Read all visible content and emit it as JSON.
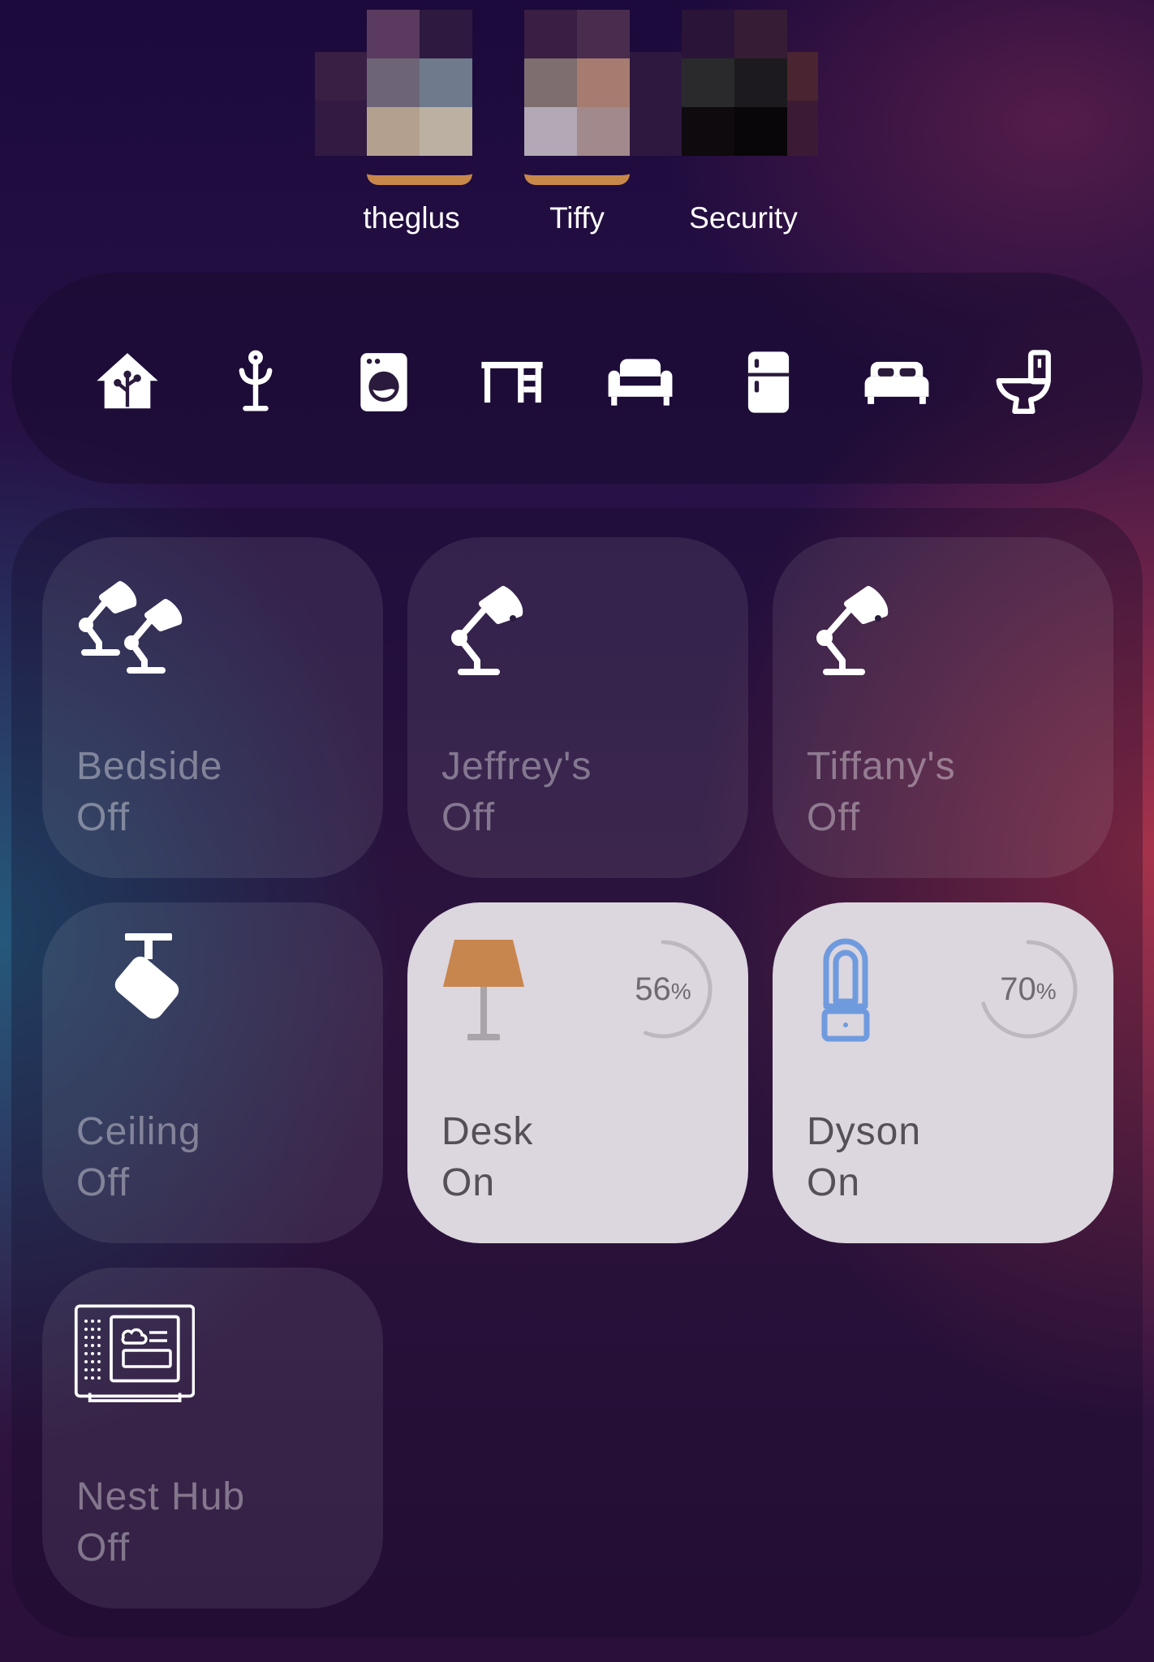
{
  "people": [
    {
      "name": "theglus",
      "accent": "#c8884a"
    },
    {
      "name": "Tiffy",
      "accent": "#c8884a"
    },
    {
      "name": "Security",
      "accent": "#4a2a3c"
    }
  ],
  "areas": [
    {
      "icon": "home-assistant-icon"
    },
    {
      "icon": "coat-rack-icon"
    },
    {
      "icon": "washing-machine-icon"
    },
    {
      "icon": "desk-icon"
    },
    {
      "icon": "sofa-icon"
    },
    {
      "icon": "fridge-icon"
    },
    {
      "icon": "bed-icon"
    },
    {
      "icon": "toilet-icon"
    }
  ],
  "tiles": [
    {
      "name": "Bedside",
      "state": "Off",
      "icon": "desk-lamp-double-icon"
    },
    {
      "name": "Jeffrey's",
      "state": "Off",
      "icon": "desk-lamp-icon"
    },
    {
      "name": "Tiffany's",
      "state": "Off",
      "icon": "desk-lamp-icon"
    },
    {
      "name": "Ceiling",
      "state": "Off",
      "icon": "ceiling-light-icon"
    },
    {
      "name": "Desk",
      "state": "On",
      "icon": "floor-lamp-icon",
      "level": 56,
      "level_unit": "%",
      "icon_color": "#c8864f"
    },
    {
      "name": "Dyson",
      "state": "On",
      "icon": "dyson-fan-icon",
      "level": 70,
      "level_unit": "%",
      "icon_color": "#6f9bde"
    },
    {
      "name": "Nest Hub",
      "state": "Off",
      "icon": "google-nest-hub-icon"
    }
  ]
}
